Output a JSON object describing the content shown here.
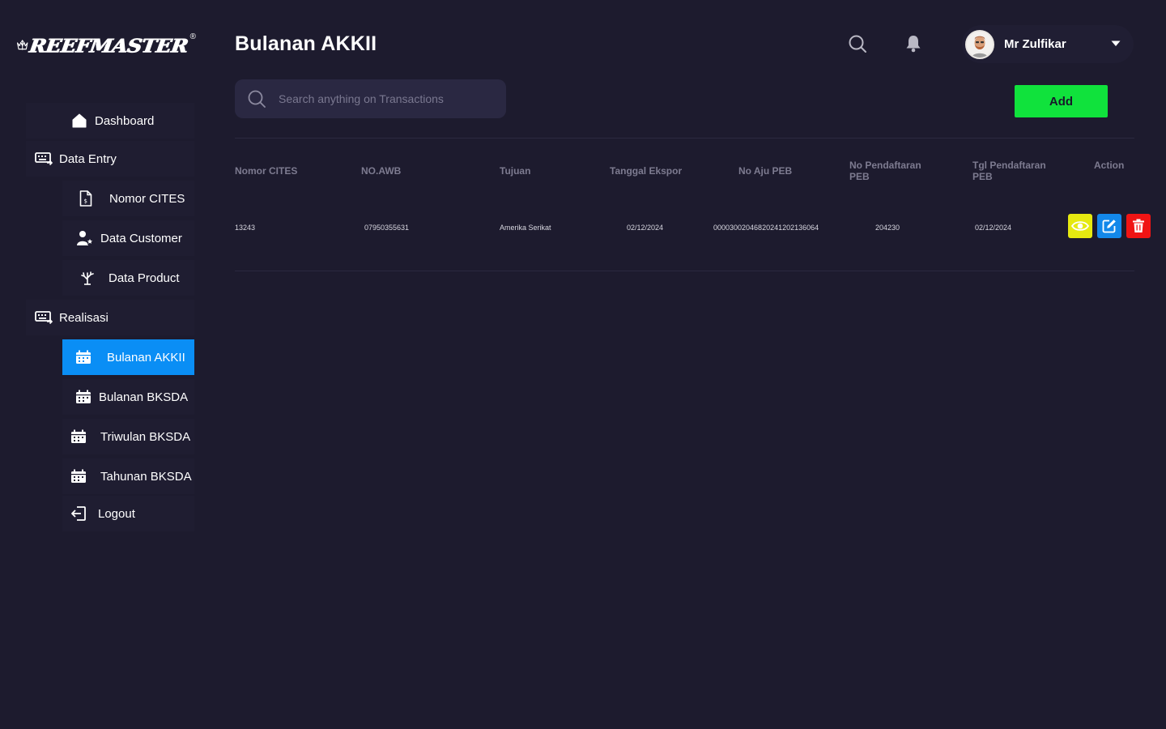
{
  "brand": {
    "name": "REEFMASTER",
    "reg": "®"
  },
  "header": {
    "title": "Bulanan AKKII",
    "user_name": "Mr Zulfikar"
  },
  "sidebar": {
    "dashboard": "Dashboard",
    "data_entry": "Data Entry",
    "nomor_cites": "Nomor CITES",
    "data_customer": "Data Customer",
    "data_product": "Data Product",
    "realisasi": "Realisasi",
    "bulanan_akkii": "Bulanan AKKII",
    "bulanan_bksda": "Bulanan BKSDA",
    "triwulan_bksda": "Triwulan BKSDA",
    "tahunan_bksda": "Tahunan BKSDA",
    "logout": "Logout"
  },
  "search": {
    "placeholder": "Search anything on Transactions"
  },
  "toolbar": {
    "add_label": "Add"
  },
  "table": {
    "headers": {
      "nomor_cites": "Nomor CITES",
      "no_awb": "NO.AWB",
      "tujuan": "Tujuan",
      "tanggal_ekspor": "Tanggal Ekspor",
      "no_aju_peb": "No Aju PEB",
      "no_pendaftaran_peb": "No Pendaftaran PEB",
      "tgl_pendaftaran_peb": "Tgl Pendaftaran PEB",
      "action": "Action"
    },
    "rows": [
      {
        "nomor_cites": "13243",
        "no_awb": "07950355631",
        "tujuan": "Amerika Serikat",
        "tanggal_ekspor": "02/12/2024",
        "no_aju_peb": "000030020468202412021360​64",
        "no_pendaftaran_peb": "204230",
        "tgl_pendaftaran_peb": "02/12/2024"
      }
    ]
  },
  "colors": {
    "background": "#1d1b2e",
    "active_nav": "#0a8ef5",
    "add_button": "#10e23c",
    "view_button": "#e6e910",
    "edit_button": "#1388ea",
    "delete_button": "#f01414"
  }
}
